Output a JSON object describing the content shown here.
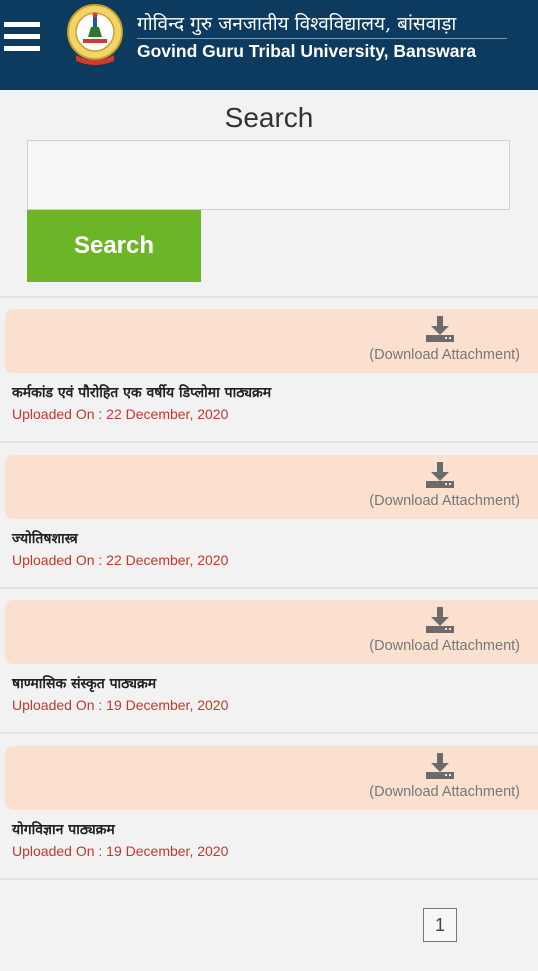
{
  "header": {
    "title_hindi": "गोविन्द गुरु जनजातीय विश्वविद्यालय, बांसवाड़ा",
    "title_english": "Govind Guru Tribal University, Banswara",
    "menu_icon": "hamburger-menu-icon",
    "logo": "university-seal-logo",
    "colors": {
      "background": "#0d3a5f",
      "text": "#ffffff"
    }
  },
  "search": {
    "heading": "Search",
    "input_value": "",
    "button_label": "Search",
    "button_color": "#6bb527"
  },
  "documents": [
    {
      "title": "कर्मकांड एवं पौरोहित एक वर्षीय डिप्लोमा पाठ्यक्रम",
      "uploaded": "Uploaded On : 22 December, 2020",
      "download_label": "(Download Attachment)",
      "icon": "download-icon"
    },
    {
      "title": "ज्योतिषशास्त्र",
      "uploaded": "Uploaded On : 22 December, 2020",
      "download_label": "(Download Attachment)",
      "icon": "download-icon"
    },
    {
      "title": "षाण्मासिक संस्कृत पाठ्यक्रम",
      "uploaded": "Uploaded On : 19 December, 2020",
      "download_label": "(Download Attachment)",
      "icon": "download-icon"
    },
    {
      "title": "योगविज्ञान पाठ्यक्रम",
      "uploaded": "Uploaded On : 19 December, 2020",
      "download_label": "(Download Attachment)",
      "icon": "download-icon"
    }
  ],
  "pagination": {
    "current_page": "1"
  },
  "colors": {
    "attachment_bg": "#fce0cf",
    "date_text": "#c0392b"
  }
}
